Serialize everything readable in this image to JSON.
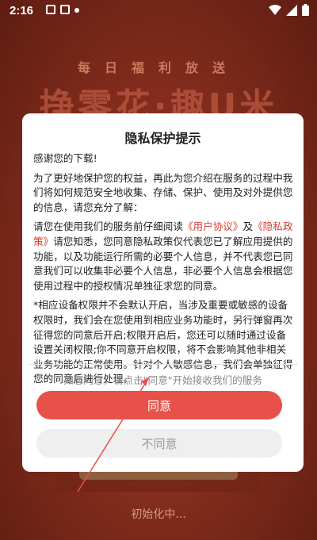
{
  "status_bar": {
    "time": "2:16"
  },
  "background": {
    "promo_small": "每日福利放送",
    "promo_big": "挣零花·趣U米",
    "loading_text": "初始化中..."
  },
  "dialog": {
    "title": "隐私保护提示",
    "greeting": "感谢您的下载!",
    "para1": "为了更好地保护您的权益，再此为您介绍在服务的过程中我们将如何规范安全地收集、存储、保护、使用及对外提供您的信息，请您充分了解：",
    "para2_prefix": "请您在使用我们的服务前仔细阅读",
    "user_agreement_link": "《用户协议》",
    "and": "及",
    "privacy_policy_link": "《隐私政策》",
    "para2_suffix": "请您知悉，您同意隐私政策仅代表您已了解应用提供的功能，以及功能运行所需的必要个人信息，并不代表您已同意我们可以收集非必要个人信息，非必要个人信息会根据您使用过程中的授权情况单独征求您的同意。",
    "para3": "*相应设备权限并不会默认开启，当涉及重要或敏感的设备权限时，我们会在您使用到相应业务功能时，另行弹窗再次征得您的同意后开启;权限开启后，您还可以随时通过设备设置关闭权限;你不同意开启权限，将不会影响其他非相关业务功能的正常使用。针对个人敏感信息，我们会单独征得您的同意后进行处理。",
    "hint": "如您同意，请点击\"同意\"开始接收我们的服务",
    "agree_label": "同意",
    "decline_label": "不同意"
  },
  "colors": {
    "accent": "#e8504a",
    "link": "#e03b2f",
    "background": "#7a2418"
  }
}
